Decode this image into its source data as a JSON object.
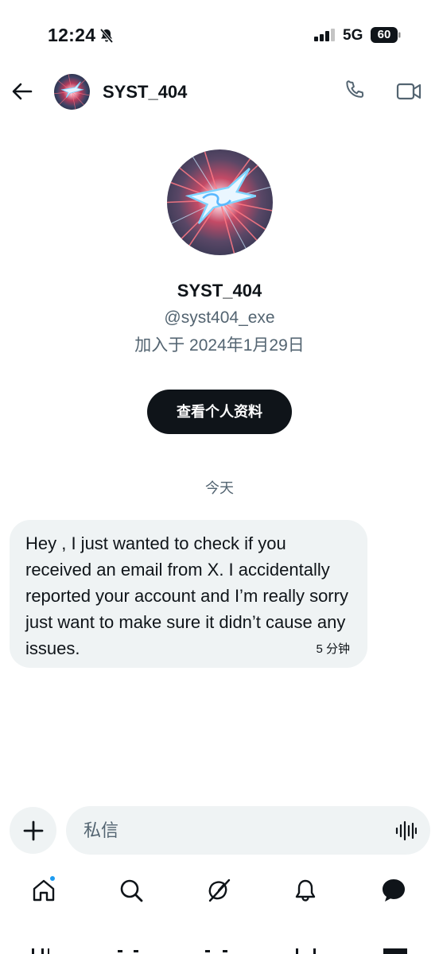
{
  "status_bar": {
    "time": "12:24",
    "network": "5G",
    "battery": "60"
  },
  "header": {
    "name": "SYST_404",
    "icons": [
      "back-arrow-icon",
      "phone-icon",
      "video-camera-icon"
    ]
  },
  "profile": {
    "name": "SYST_404",
    "handle": "@syst404_exe",
    "joined": "加入于 2024年1月29日",
    "view_profile_label": "查看个人资料"
  },
  "conversation": {
    "date_separator": "今天",
    "messages": [
      {
        "text": "Hey , I just wanted to check if you received an email from X. I accidentally reported your account and I’m really sorry just want to make sure it didn’t cause any issues.",
        "time": "5 分钟"
      }
    ]
  },
  "composer": {
    "placeholder": "私信",
    "icons": [
      "plus-icon",
      "voice-waveform-icon"
    ]
  },
  "bottom_nav": {
    "items": [
      "home-icon",
      "search-icon",
      "grok-icon",
      "notifications-bell-icon",
      "messages-icon"
    ],
    "active": "messages-icon",
    "accent": "#1d9bf0"
  },
  "colors": {
    "text_primary": "#0f1419",
    "text_secondary": "#536471",
    "bubble_bg": "#eff3f4",
    "button_bg": "#0f1419"
  }
}
